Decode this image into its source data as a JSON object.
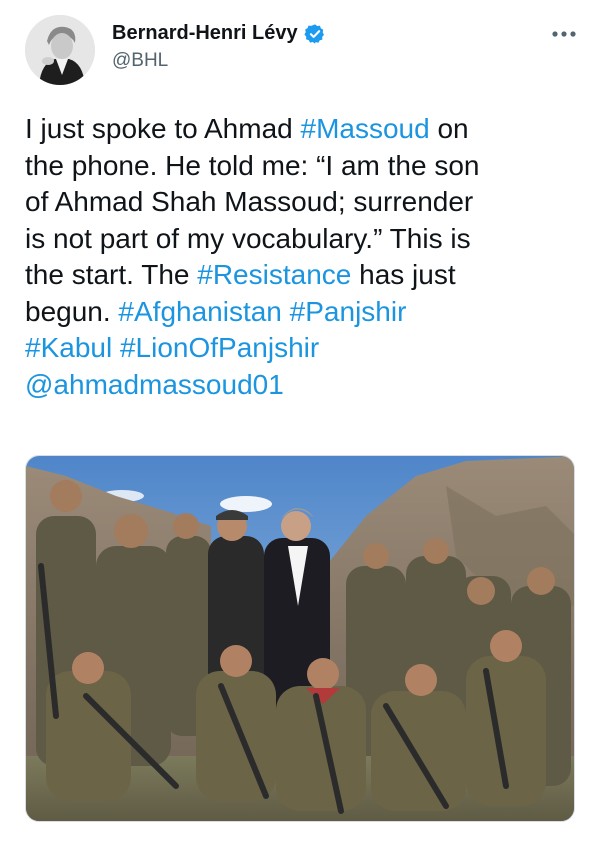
{
  "author": {
    "display_name": "Bernard-Henri Lévy",
    "handle": "@BHL",
    "verified": true,
    "verified_icon": "verified-badge-icon",
    "avatar_icon": "profile-photo"
  },
  "menu": {
    "icon": "more-options-icon"
  },
  "tweet": {
    "lines": [
      [
        {
          "text": "I just spoke to Ahmad "
        },
        {
          "text": "#Massoud",
          "link": true
        },
        {
          "text": " on"
        }
      ],
      [
        {
          "text": "the phone. He told me: “I am the son"
        }
      ],
      [
        {
          "text": "of Ahmad Shah Massoud; surrender"
        }
      ],
      [
        {
          "text": "is not part of my vocabulary.” This is"
        }
      ],
      [
        {
          "text": "the start. The "
        },
        {
          "text": "#Resistance",
          "link": true
        },
        {
          "text": " has just"
        }
      ],
      [
        {
          "text": "begun. "
        },
        {
          "text": "#Afghanistan",
          "link": true
        },
        {
          "text": " "
        },
        {
          "text": "#Panjshir",
          "link": true
        }
      ],
      [
        {
          "text": "#Kabul",
          "link": true
        },
        {
          "text": " "
        },
        {
          "text": "#LionOfPanjshir",
          "link": true
        }
      ],
      [
        {
          "text": "@ahmadmassoud01",
          "link": true
        }
      ]
    ]
  },
  "media": {
    "type": "photo",
    "alt_icon": "group-photo-image"
  },
  "colors": {
    "link": "#1b95e0",
    "text": "#0f1419",
    "secondary": "#536471",
    "verified": "#1d9bf0"
  }
}
